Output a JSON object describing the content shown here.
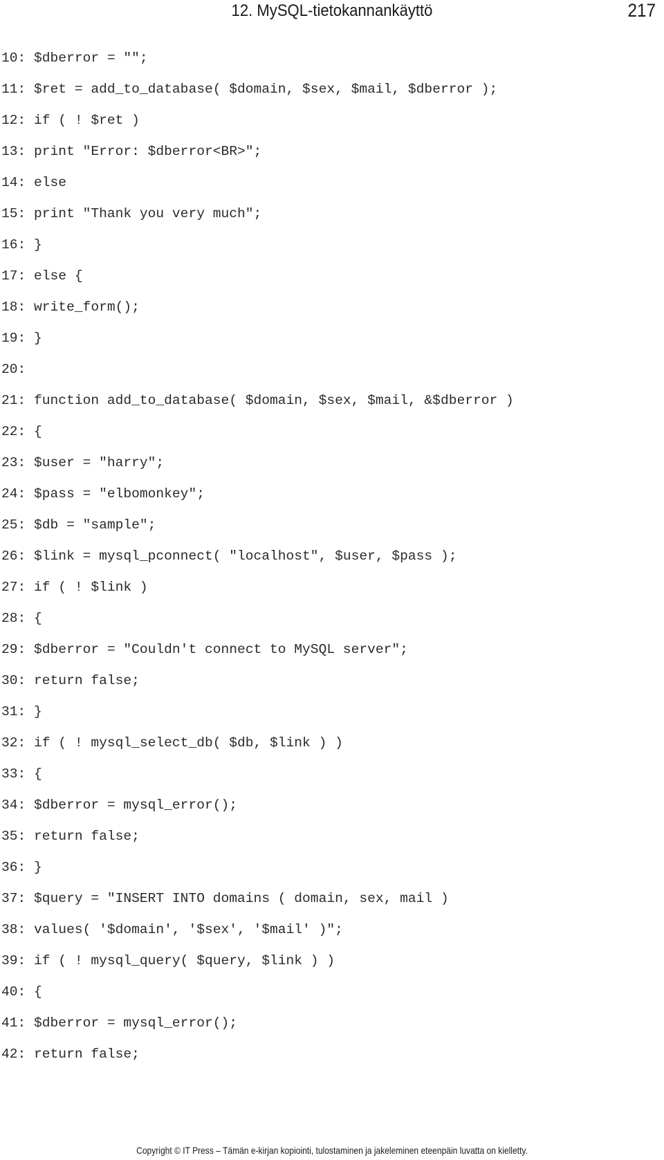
{
  "header": {
    "chapter_title": "12. MySQL-tietokannankäyttö",
    "page_number": "217"
  },
  "code_lines": [
    "10: $dberror = \"\";",
    "11: $ret = add_to_database( $domain, $sex, $mail, $dberror );",
    "12: if ( ! $ret )",
    "13: print \"Error: $dberror<BR>\";",
    "14: else",
    "15: print \"Thank you very much\";",
    "16: }",
    "17: else {",
    "18: write_form();",
    "19: }",
    "20:",
    "21: function add_to_database( $domain, $sex, $mail, &$dberror )",
    "22: {",
    "23: $user = \"harry\";",
    "24: $pass = \"elbomonkey\";",
    "25: $db = \"sample\";",
    "26: $link = mysql_pconnect( \"localhost\", $user, $pass );",
    "27: if ( ! $link )",
    "28: {",
    "29: $dberror = \"Couldn't connect to MySQL server\";",
    "30: return false;",
    "31: }",
    "32: if ( ! mysql_select_db( $db, $link ) )",
    "33: {",
    "34: $dberror = mysql_error();",
    "35: return false;",
    "36: }",
    "37: $query = \"INSERT INTO domains ( domain, sex, mail )",
    "38: values( '$domain', '$sex', '$mail' )\";",
    "39: if ( ! mysql_query( $query, $link ) )",
    "40: {",
    "41: $dberror = mysql_error();",
    "42: return false;"
  ],
  "footer": {
    "copyright": "Copyright © IT Press – Tämän e-kirjan kopiointi, tulostaminen ja jakeleminen eteenpäin luvatta on kielletty."
  }
}
